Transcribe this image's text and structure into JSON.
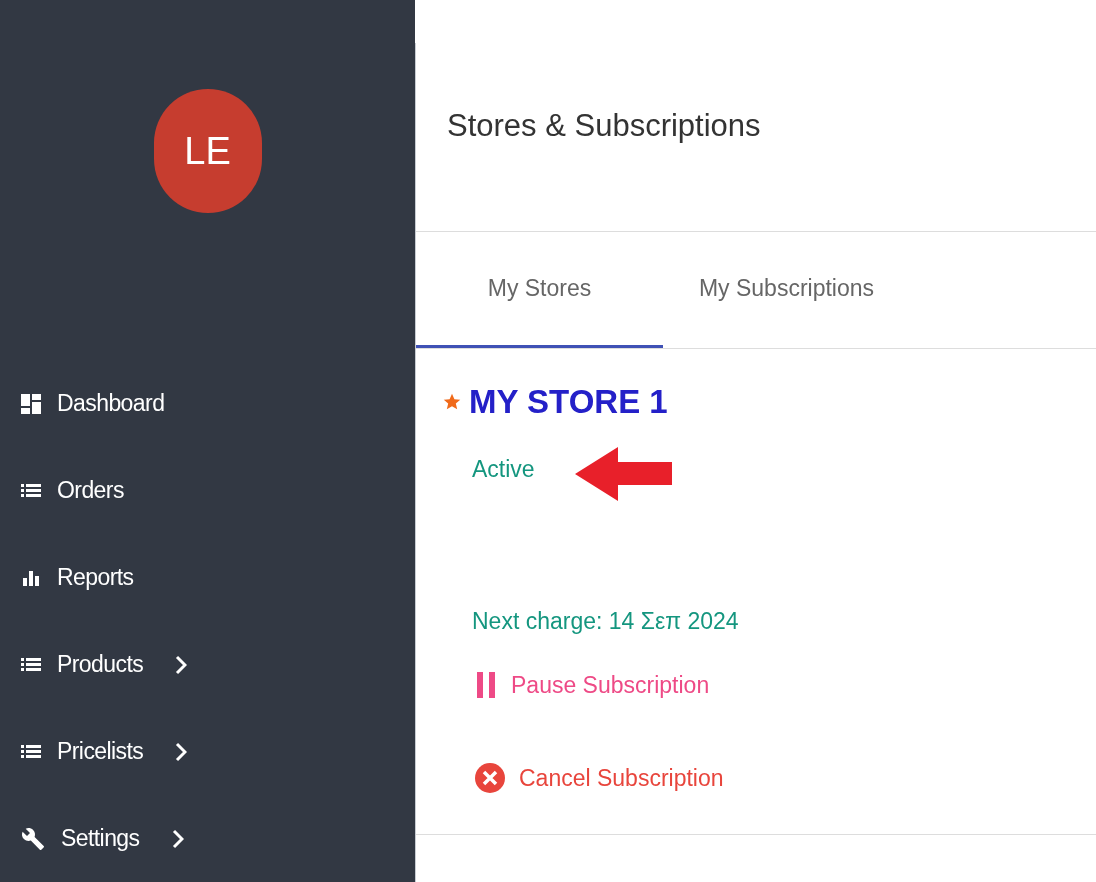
{
  "sidebar": {
    "avatar": "LE",
    "items": [
      {
        "label": "Dashboard",
        "has_submenu": false
      },
      {
        "label": "Orders",
        "has_submenu": false
      },
      {
        "label": "Reports",
        "has_submenu": false
      },
      {
        "label": "Products",
        "has_submenu": true
      },
      {
        "label": "Pricelists",
        "has_submenu": true
      },
      {
        "label": "Settings",
        "has_submenu": true
      }
    ]
  },
  "page": {
    "title": "Stores & Subscriptions"
  },
  "tabs": [
    {
      "label": "My Stores",
      "selected": true
    },
    {
      "label": "My Subscriptions",
      "selected": false
    }
  ],
  "store": {
    "name": "MY STORE 1",
    "favorite": true,
    "status": "Active",
    "next_charge": "Next charge: 14 Σεπ 2024",
    "actions": [
      {
        "kind": "pause",
        "label": "Pause Subscription"
      },
      {
        "kind": "cancel",
        "label": "Cancel Subscription"
      }
    ]
  }
}
